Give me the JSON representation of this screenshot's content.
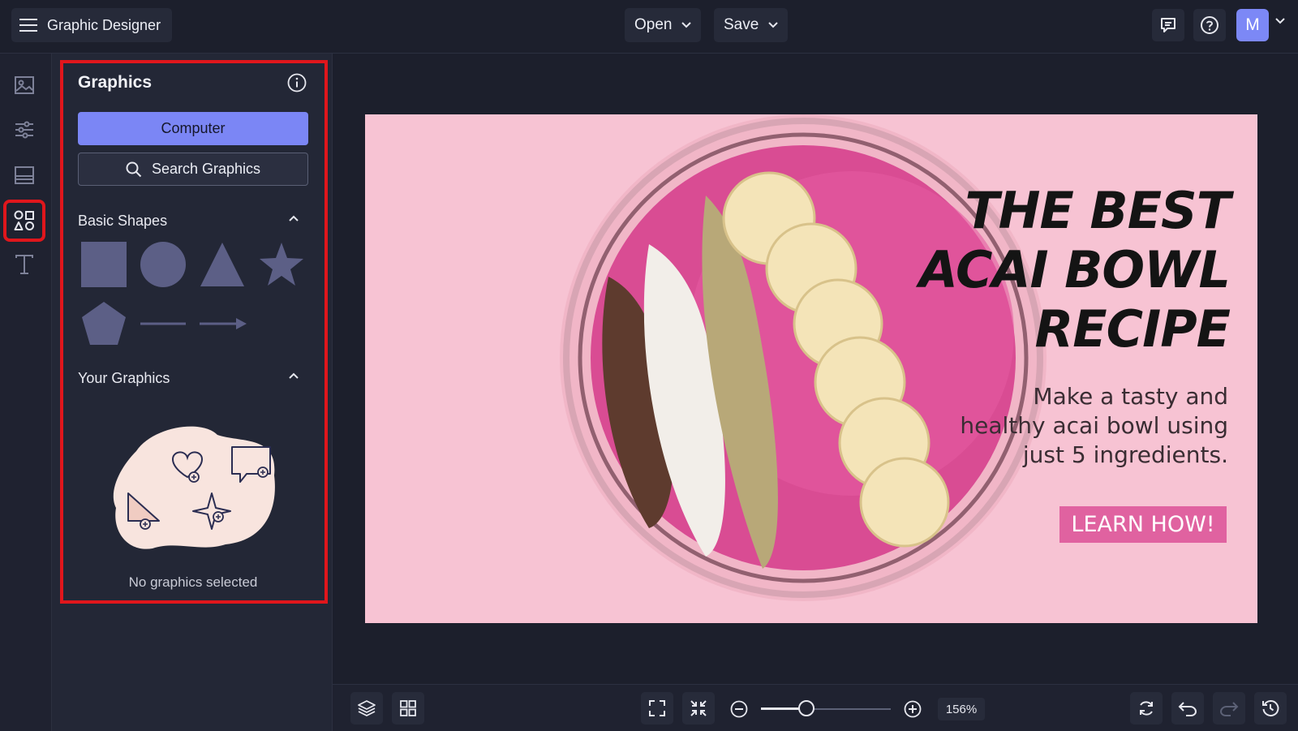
{
  "app": {
    "title": "Graphic Designer"
  },
  "topbar": {
    "open_label": "Open",
    "save_label": "Save",
    "avatar_initial": "M"
  },
  "rail": {
    "items": [
      {
        "icon": "image-icon"
      },
      {
        "icon": "sliders-icon"
      },
      {
        "icon": "layout-icon"
      },
      {
        "icon": "shapes-icon",
        "active": true
      },
      {
        "icon": "text-icon"
      }
    ]
  },
  "panel": {
    "title": "Graphics",
    "computer_label": "Computer",
    "search_label": "Search Graphics",
    "basic_shapes_title": "Basic Shapes",
    "your_graphics_title": "Your Graphics",
    "empty_text": "No graphics selected"
  },
  "design": {
    "headline_1": "THE BEST",
    "headline_2": "ACAI BOWL",
    "headline_3": "RECIPE",
    "sub_1": "Make a tasty and",
    "sub_2": "healthy acai bowl using",
    "sub_3": "just 5 ingredients.",
    "cta": "LEARN HOW!"
  },
  "bottombar": {
    "zoom_label": "156%",
    "zoom_fraction": 0.35
  },
  "colors": {
    "accent": "#7b86f5",
    "highlight": "#e0161c",
    "design_bg": "#f7c3d3",
    "cta_bg": "#e062a0",
    "shape_fill": "#5c5f86"
  }
}
